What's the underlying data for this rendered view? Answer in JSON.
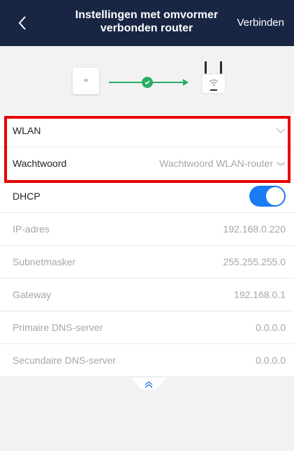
{
  "header": {
    "title_line1": "Instellingen met omvormer",
    "title_line2": "verbonden router",
    "connect_label": "Verbinden"
  },
  "colors": {
    "header_bg": "#182644",
    "accent_green": "#2aae62",
    "toggle_blue": "#1a7cf0",
    "highlight_red": "#e80000"
  },
  "settings": {
    "wlan": {
      "label": "WLAN"
    },
    "password": {
      "label": "Wachtwoord",
      "placeholder": "Wachtwoord WLAN-router"
    },
    "dhcp": {
      "label": "DHCP",
      "enabled": true
    },
    "ip": {
      "label": "IP-adres",
      "value": "192.168.0.220"
    },
    "subnet": {
      "label": "Subnetmasker",
      "value": "255.255.255.0"
    },
    "gateway": {
      "label": "Gateway",
      "value": "192.168.0.1"
    },
    "dns1": {
      "label": "Primaire DNS-server",
      "value": "0.0.0.0"
    },
    "dns2": {
      "label": "Secundaire DNS-server",
      "value": "0.0.0.0"
    }
  },
  "icons": {
    "back": "chevron-left-icon",
    "wlan_dropdown": "chevron-down-icon",
    "password_visibility": "eye-closed-icon",
    "expand": "double-chevron-up-icon"
  }
}
